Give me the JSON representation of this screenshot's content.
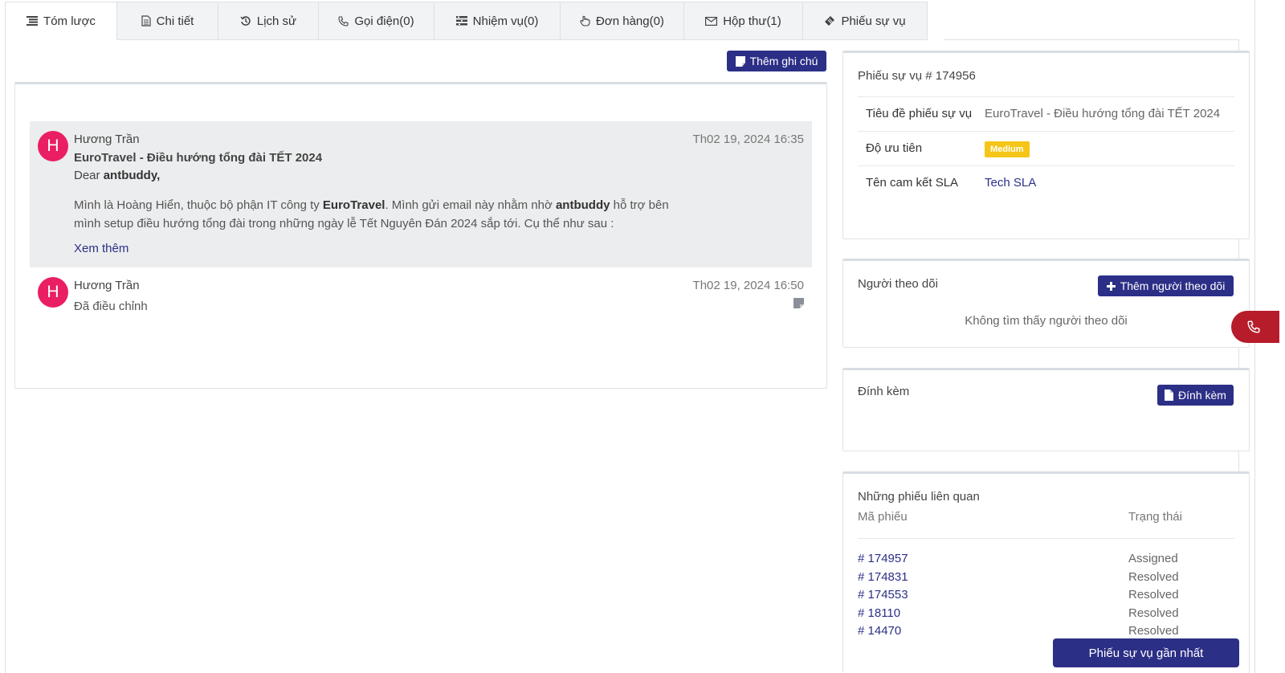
{
  "tabs": [
    {
      "label": "Tóm lược",
      "icon": "list-icon",
      "active": true
    },
    {
      "label": "Chi tiết",
      "icon": "document-icon",
      "active": false
    },
    {
      "label": "Lịch sử",
      "icon": "history-icon",
      "active": false
    },
    {
      "label": "Gọi điện(0)",
      "icon": "phone-icon",
      "active": false
    },
    {
      "label": "Nhiệm vụ(0)",
      "icon": "tasks-icon",
      "active": false
    },
    {
      "label": "Đơn hàng(0)",
      "icon": "hand-pointer-icon",
      "active": false
    },
    {
      "label": "Hộp thư(1)",
      "icon": "envelope-icon",
      "active": false
    },
    {
      "label": "Phiếu sự vụ",
      "icon": "ticket-icon",
      "active": false
    }
  ],
  "notes": {
    "add_note_label": "Thêm ghi chú",
    "items": [
      {
        "avatar": "H",
        "author": "Hương Trần",
        "time": "Th02 19, 2024 16:35",
        "subject": "EuroTravel - Điều hướng tổng đài TẾT 2024",
        "greeting_prefix": "Dear ",
        "greeting_name": "antbuddy,",
        "body_1": "Mình là Hoàng Hiển, thuộc bộ phận IT công ty ",
        "body_company": "EuroTravel",
        "body_2": ". Mình gửi email này nhằm nhờ ",
        "body_vendor": "antbuddy",
        "body_3": " hỗ trợ bên mình setup điều hướng tổng đài trong những ngày lễ Tết Nguyên Đán 2024 sắp tới. Cụ thể như sau :",
        "more_link": "Xem thêm"
      },
      {
        "avatar": "H",
        "author": "Hương Trần",
        "time": "Th02 19, 2024 16:50",
        "text": "Đã điều chỉnh"
      }
    ]
  },
  "ticket": {
    "title": "Phiếu sự vụ # 174956",
    "rows": [
      {
        "label": "Tiêu đề phiếu sự vụ",
        "value": "EuroTravel - Điều hướng tổng đài TẾT 2024"
      },
      {
        "label": "Độ ưu tiên",
        "value": "Medium"
      },
      {
        "label": "Tên cam kết SLA",
        "value": "Tech SLA"
      }
    ]
  },
  "followers": {
    "title": "Người theo dõi",
    "add_label": "Thêm người theo dõi",
    "empty_text": "Không tìm thấy người theo dõi"
  },
  "attachments": {
    "title": "Đính kèm",
    "button_label": "Đính kèm"
  },
  "related": {
    "title": "Những phiếu liên quan",
    "col_id": "Mã phiếu",
    "col_status": "Trạng thái",
    "rows": [
      {
        "id": "# 174957",
        "status": "Assigned"
      },
      {
        "id": "# 174831",
        "status": "Resolved"
      },
      {
        "id": "# 174553",
        "status": "Resolved"
      },
      {
        "id": "# 18110",
        "status": "Resolved"
      },
      {
        "id": "# 14470",
        "status": "Resolved"
      }
    ],
    "recent_button": "Phiếu sự vụ gần nhất"
  },
  "colors": {
    "primary": "#2c2f86",
    "avatar": "#e91e63",
    "badge_medium": "#f5c518",
    "call_button": "#b71c2a"
  }
}
